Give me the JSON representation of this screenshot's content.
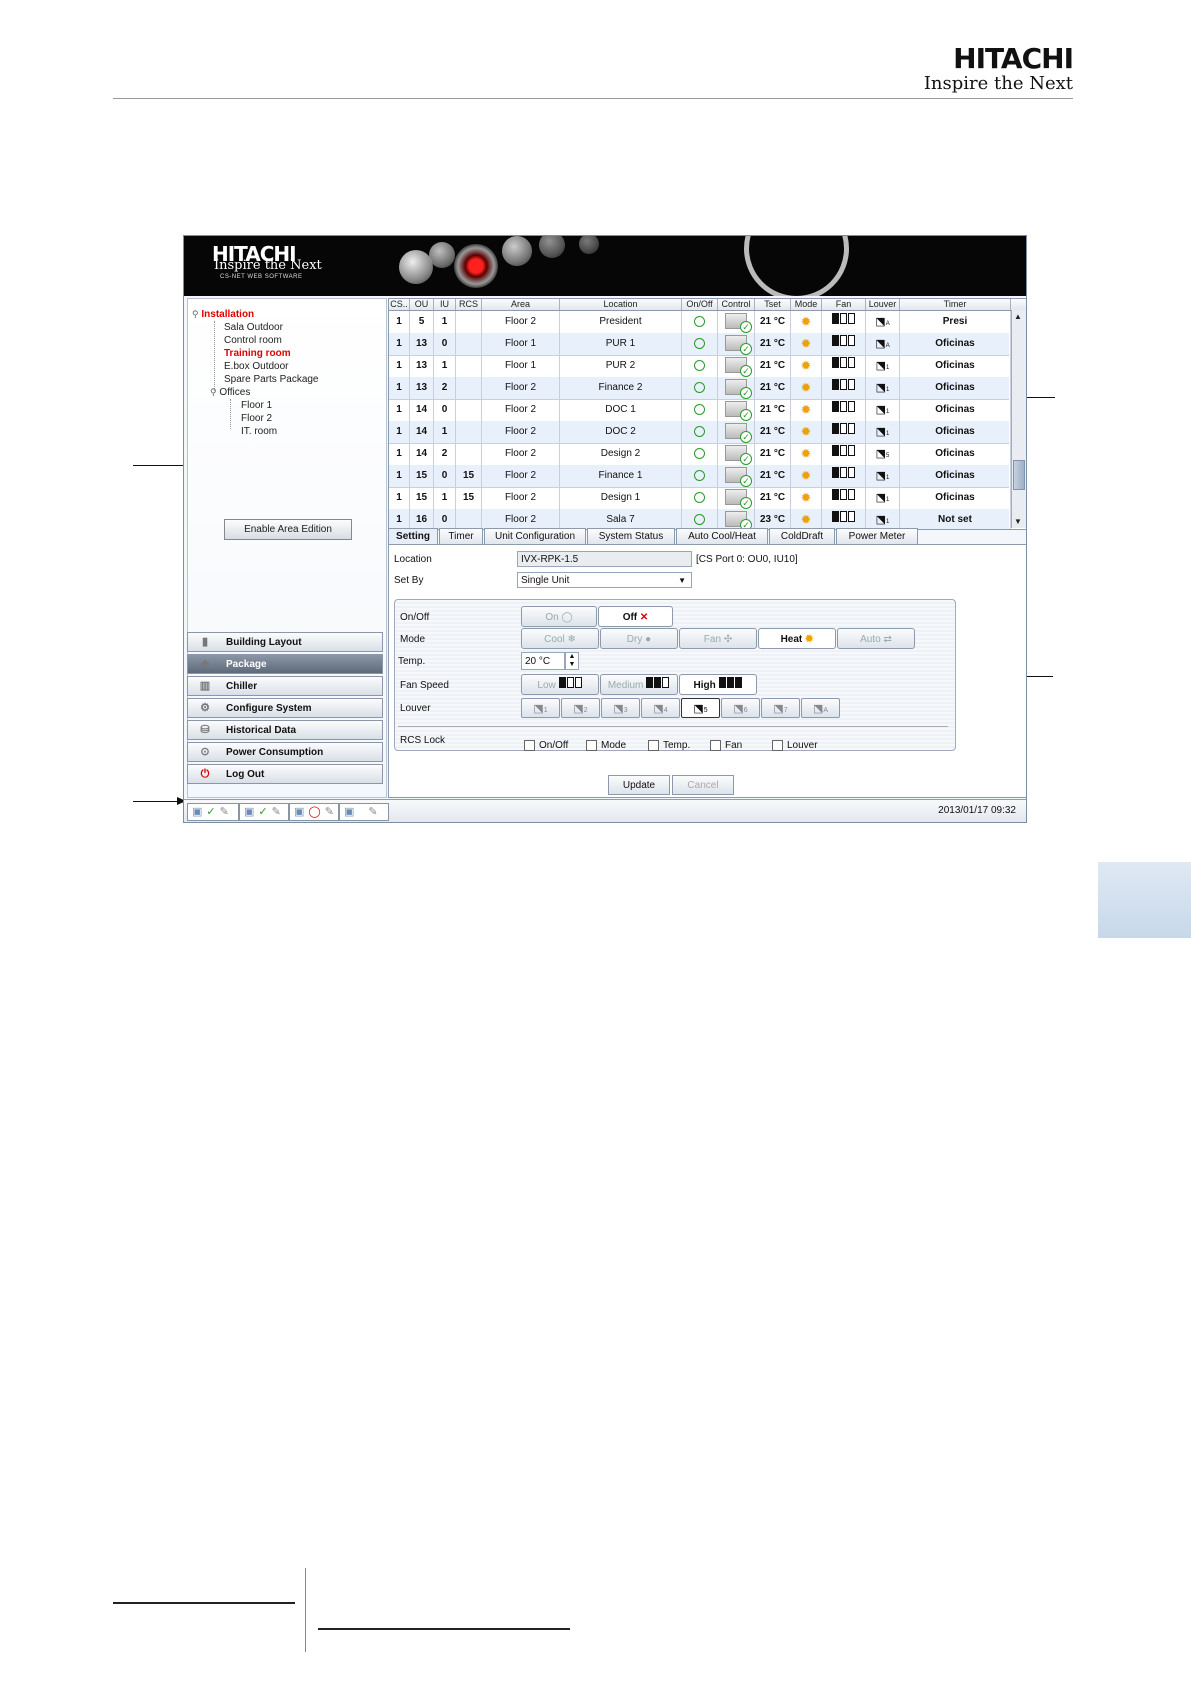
{
  "page": {
    "brand": "HITACHI",
    "tagline": "Inspire the Next"
  },
  "app": {
    "banner": {
      "brand": "HITACHI",
      "tagline": "Inspire the Next",
      "subtitle": "CS-NET WEB SOFTWARE"
    },
    "tree": {
      "root": "Installation",
      "items": [
        "Sala Outdoor",
        "Control room",
        "Training room",
        "E.box Outdoor",
        "Spare Parts Package"
      ],
      "group": "Offices",
      "subitems": [
        "Floor 1",
        "Floor 2",
        "IT. room"
      ]
    },
    "enable_area_edition": "Enable Area Edition",
    "nav": [
      "Building Layout",
      "Package",
      "Chiller",
      "Configure System",
      "Historical Data",
      "Power Consumption",
      "Log Out"
    ],
    "table": {
      "headers": [
        "CS..",
        "OU",
        "IU",
        "RCS",
        "Area",
        "Location",
        "On/Off",
        "Control",
        "Tset",
        "Mode",
        "Fan",
        "Louver",
        "Timer"
      ],
      "rows": [
        {
          "cs": "1",
          "ou": "5",
          "iu": "1",
          "rcs": "",
          "area": "Floor 2",
          "location": "President",
          "tset": "21 °C",
          "louver": "A",
          "timer": "Presi"
        },
        {
          "cs": "1",
          "ou": "13",
          "iu": "0",
          "rcs": "",
          "area": "Floor 1",
          "location": "PUR 1",
          "tset": "21 °C",
          "louver": "A",
          "timer": "Oficinas"
        },
        {
          "cs": "1",
          "ou": "13",
          "iu": "1",
          "rcs": "",
          "area": "Floor 1",
          "location": "PUR 2",
          "tset": "21 °C",
          "louver": "1",
          "timer": "Oficinas"
        },
        {
          "cs": "1",
          "ou": "13",
          "iu": "2",
          "rcs": "",
          "area": "Floor 2",
          "location": "Finance 2",
          "tset": "21 °C",
          "louver": "1",
          "timer": "Oficinas"
        },
        {
          "cs": "1",
          "ou": "14",
          "iu": "0",
          "rcs": "",
          "area": "Floor 2",
          "location": "DOC 1",
          "tset": "21 °C",
          "louver": "1",
          "timer": "Oficinas"
        },
        {
          "cs": "1",
          "ou": "14",
          "iu": "1",
          "rcs": "",
          "area": "Floor 2",
          "location": "DOC 2",
          "tset": "21 °C",
          "louver": "1",
          "timer": "Oficinas"
        },
        {
          "cs": "1",
          "ou": "14",
          "iu": "2",
          "rcs": "",
          "area": "Floor 2",
          "location": "Design 2",
          "tset": "21 °C",
          "louver": "5",
          "timer": "Oficinas"
        },
        {
          "cs": "1",
          "ou": "15",
          "iu": "0",
          "rcs": "15",
          "area": "Floor 2",
          "location": "Finance 1",
          "tset": "21 °C",
          "louver": "1",
          "timer": "Oficinas"
        },
        {
          "cs": "1",
          "ou": "15",
          "iu": "1",
          "rcs": "15",
          "area": "Floor 2",
          "location": "Design 1",
          "tset": "21 °C",
          "louver": "1",
          "timer": "Oficinas"
        },
        {
          "cs": "1",
          "ou": "16",
          "iu": "0",
          "rcs": "",
          "area": "Floor 2",
          "location": "Sala 7",
          "tset": "23 °C",
          "louver": "1",
          "timer": "Not set"
        }
      ]
    },
    "tabs": [
      "Setting",
      "Timer",
      "Unit Configuration",
      "System Status",
      "Auto Cool/Heat",
      "ColdDraft",
      "Power Meter"
    ],
    "setting": {
      "location_label": "Location",
      "location_value": "IVX-RPK-1.5",
      "location_port": "[CS Port 0: OU0, IU10]",
      "set_by_label": "Set By",
      "set_by_value": "Single Unit",
      "onoff_label": "On/Off",
      "on": "On",
      "off": "Off",
      "mode_label": "Mode",
      "cool": "Cool",
      "dry": "Dry",
      "fan": "Fan",
      "heat": "Heat",
      "auto": "Auto",
      "temp_label": "Temp.",
      "temp_value": "20 °C",
      "fan_speed_label": "Fan Speed",
      "low": "Low",
      "medium": "Medium",
      "high": "High",
      "louver_label": "Louver",
      "louver_positions": [
        "1",
        "2",
        "3",
        "4",
        "5",
        "6",
        "7",
        "A"
      ],
      "rcs_lock_label": "RCS Lock",
      "rcs_options": [
        "On/Off",
        "Mode",
        "Temp.",
        "Fan",
        "Louver"
      ],
      "update": "Update",
      "cancel": "Cancel"
    },
    "status_time": "2013/01/17 09:32"
  },
  "colors": {
    "accent_red": "#e00000",
    "row_alt": "#e8f0fb",
    "on_green": "#2a9a2a",
    "heat_sun": "#f0a000"
  }
}
